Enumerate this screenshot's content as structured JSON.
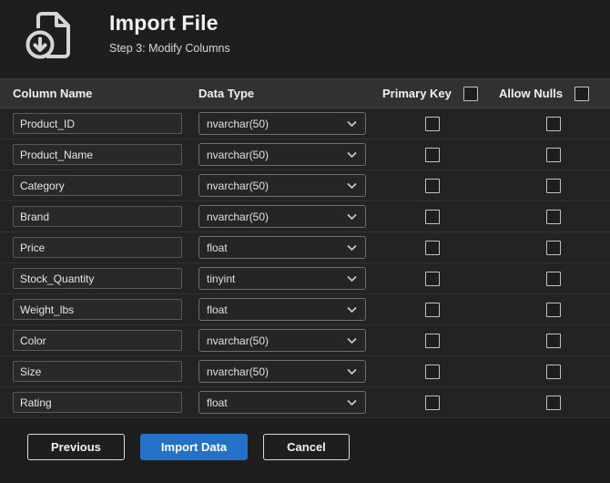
{
  "header": {
    "title": "Import File",
    "subtitle": "Step 3: Modify Columns",
    "icon": "import-file-icon"
  },
  "table": {
    "headers": {
      "column_name": "Column Name",
      "data_type": "Data Type",
      "primary_key": "Primary Key",
      "allow_nulls": "Allow Nulls"
    },
    "header_checkboxes": {
      "primary_key_checked": false,
      "allow_nulls_checked": false
    },
    "rows": [
      {
        "name": "Product_ID",
        "type": "nvarchar(50)",
        "primary_key": false,
        "allow_nulls": false
      },
      {
        "name": "Product_Name",
        "type": "nvarchar(50)",
        "primary_key": false,
        "allow_nulls": false
      },
      {
        "name": "Category",
        "type": "nvarchar(50)",
        "primary_key": false,
        "allow_nulls": false
      },
      {
        "name": "Brand",
        "type": "nvarchar(50)",
        "primary_key": false,
        "allow_nulls": false
      },
      {
        "name": "Price",
        "type": "float",
        "primary_key": false,
        "allow_nulls": false
      },
      {
        "name": "Stock_Quantity",
        "type": "tinyint",
        "primary_key": false,
        "allow_nulls": false
      },
      {
        "name": "Weight_lbs",
        "type": "float",
        "primary_key": false,
        "allow_nulls": false
      },
      {
        "name": "Color",
        "type": "nvarchar(50)",
        "primary_key": false,
        "allow_nulls": false
      },
      {
        "name": "Size",
        "type": "nvarchar(50)",
        "primary_key": false,
        "allow_nulls": false
      },
      {
        "name": "Rating",
        "type": "float",
        "primary_key": false,
        "allow_nulls": false
      }
    ]
  },
  "footer": {
    "previous_label": "Previous",
    "import_label": "Import Data",
    "cancel_label": "Cancel"
  },
  "colors": {
    "accent_blue": "#2472c8",
    "background": "#1e1e1e",
    "header_band": "#313134"
  }
}
